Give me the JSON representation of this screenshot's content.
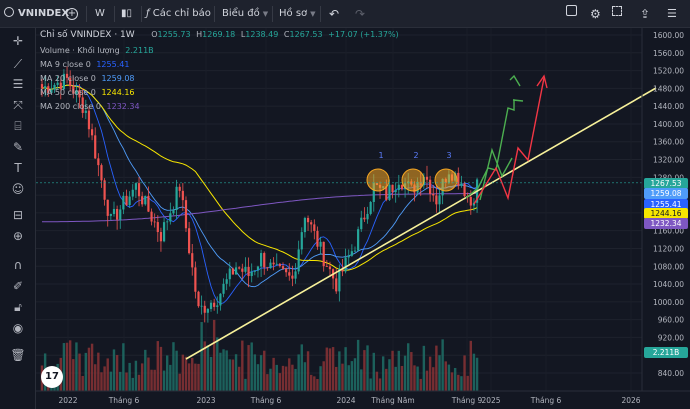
{
  "toolbar": {
    "symbol": "VNINDEX",
    "interval": "W",
    "indicators_label": "Các chỉ báo",
    "charts_label": "Biểu đồ",
    "profile_label": "Hồ sơ"
  },
  "legend": {
    "title": "Chỉ số VNINDEX · 1W",
    "ohlc": {
      "o_label": "O",
      "o": "1255.73",
      "h_label": "H",
      "h": "1269.18",
      "l_label": "L",
      "l": "1238.49",
      "c_label": "C",
      "c": "1267.53",
      "change": "+17.07 (+1.37%)"
    },
    "volume_label": "Volume · Khối lượng",
    "volume_value": "2.211B",
    "ma_rows": [
      {
        "label": "MA 9 close 0",
        "value": "1255.41",
        "color": "#2962ff"
      },
      {
        "label": "MA 20 close 0",
        "value": "1259.08",
        "color": "#4f9cf9"
      },
      {
        "label": "MA 50 close 0",
        "value": "1244.16",
        "color": "#f7e600"
      },
      {
        "label": "MA 200 close 0",
        "value": "1232.34",
        "color": "#7e57c2"
      }
    ]
  },
  "price_axis": {
    "ticks": [
      "1600.00",
      "1560.00",
      "1520.00",
      "1480.00",
      "1440.00",
      "1400.00",
      "1360.00",
      "1320.00",
      "1280.00",
      "1240.00",
      "1200.00",
      "1160.00",
      "1120.00",
      "1080.00",
      "1040.00",
      "1000.00",
      "960.00",
      "920.00",
      "880.00",
      "840.00"
    ],
    "tags": [
      {
        "value": "1267.53",
        "color": "#26a69a"
      },
      {
        "value": "1259.08",
        "color": "#4f9cf9"
      },
      {
        "value": "1255.41",
        "color": "#2962ff"
      },
      {
        "value": "1244.16",
        "color": "#f7e600"
      },
      {
        "value": "1232.34",
        "color": "#7e57c2"
      },
      {
        "value": "2.211B",
        "color": "#26a69a"
      }
    ]
  },
  "time_axis": {
    "labels": [
      "2022",
      "Tháng 6",
      "2023",
      "Tháng 6",
      "2024",
      "Tháng Năm",
      "Tháng 9",
      "2025",
      "Tháng 6",
      "2026"
    ]
  },
  "annotations": {
    "peak_labels": [
      "1",
      "2",
      "3"
    ]
  },
  "colors": {
    "up": "#26a69a",
    "down": "#ef5350",
    "trendline": "#f7f19a",
    "arrow_green": "#4caf50",
    "arrow_red": "#f23645",
    "peak_circle": "#f5a623"
  },
  "icons": [
    "search-icon",
    "add-icon",
    "candles-icon",
    "indicators-icon",
    "layout-icon",
    "undo-icon",
    "redo-icon",
    "crosshair-icon",
    "trendline-icon",
    "fib-icon",
    "pattern-icon",
    "brush-icon",
    "text-icon",
    "emoji-icon",
    "ruler-icon",
    "zoom-icon",
    "magnet-icon",
    "lock-icon",
    "eye-icon",
    "trash-icon"
  ]
}
